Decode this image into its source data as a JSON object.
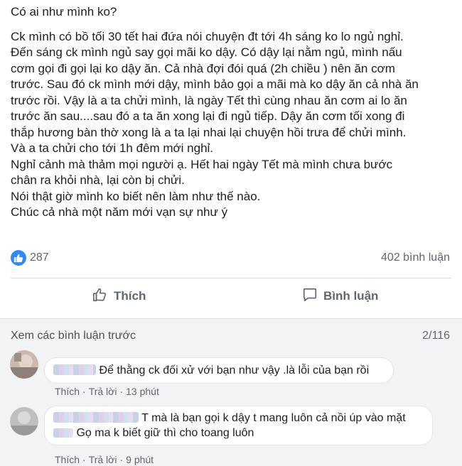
{
  "post": {
    "intro": "Có ai như mình ko?",
    "paragraph": "Ck mình có bồ tối 30 tết hai đứa nói chuyện đt tới 4h sáng ko lo ngủ nghỉ.\nĐến sáng ck mình ngủ say gọi mãi ko dậy. Có dậy lại nằm ngủ, mình nấu\ncơm gọi đi gọi lại ko dậy ăn. Cả nhà đợi đói quá (2h chiều ) nên ăn cơm\ntrước. Sau đó ck mình mới dậy, mình bảo gọi a mãi mà ko dậy ăn cả nhà ăn\ntrước rồi. Vậy là a ta chửi mình, là ngày Tết thì cùng nhau ăn cơm ai lo ăn\ntrước ăn sau....sau đó a ta ăn xong lại đi ngủ tiếp. Dậy ăn cơm tối xong đi\nthắp hương bàn thờ xong là a ta lại nhai lại chuyện hồi trưa để chửi mình.\nVà a ta chửi cho tới 1h đêm mới nghỉ.\nNghỉ cảnh mà thảm mọi người ạ. Hết hai ngày Tết mà mình chưa bước\nchân ra khỏi nhà, lại còn bị chửi.\nNói thật giờ mình ko biết nên làm như thế nào.\nChúc cả nhà một năm mới vạn sự như ý"
  },
  "stats": {
    "likes": "287",
    "comments": "402 bình luận",
    "like_color": "#2e89ff"
  },
  "actions": {
    "like": "Thích",
    "comment": "Bình luận"
  },
  "comments_section": {
    "view_previous": "Xem các bình luận trước",
    "pager": "2/116",
    "items": [
      {
        "text": "Để thằng ck đối xử với bạn như vậy .là lỗi của bạn rồi",
        "like": "Thích",
        "reply": "Trả lời",
        "time": "13 phút"
      },
      {
        "line1": "T mà là bạn gọi k dậy t mang luôn cả nồi úp vào mặt",
        "line2": "Gọ ma k biết giữ thì cho toang luôn",
        "like": "Thích",
        "reply": "Trả lời",
        "time": "9 phút"
      }
    ]
  }
}
